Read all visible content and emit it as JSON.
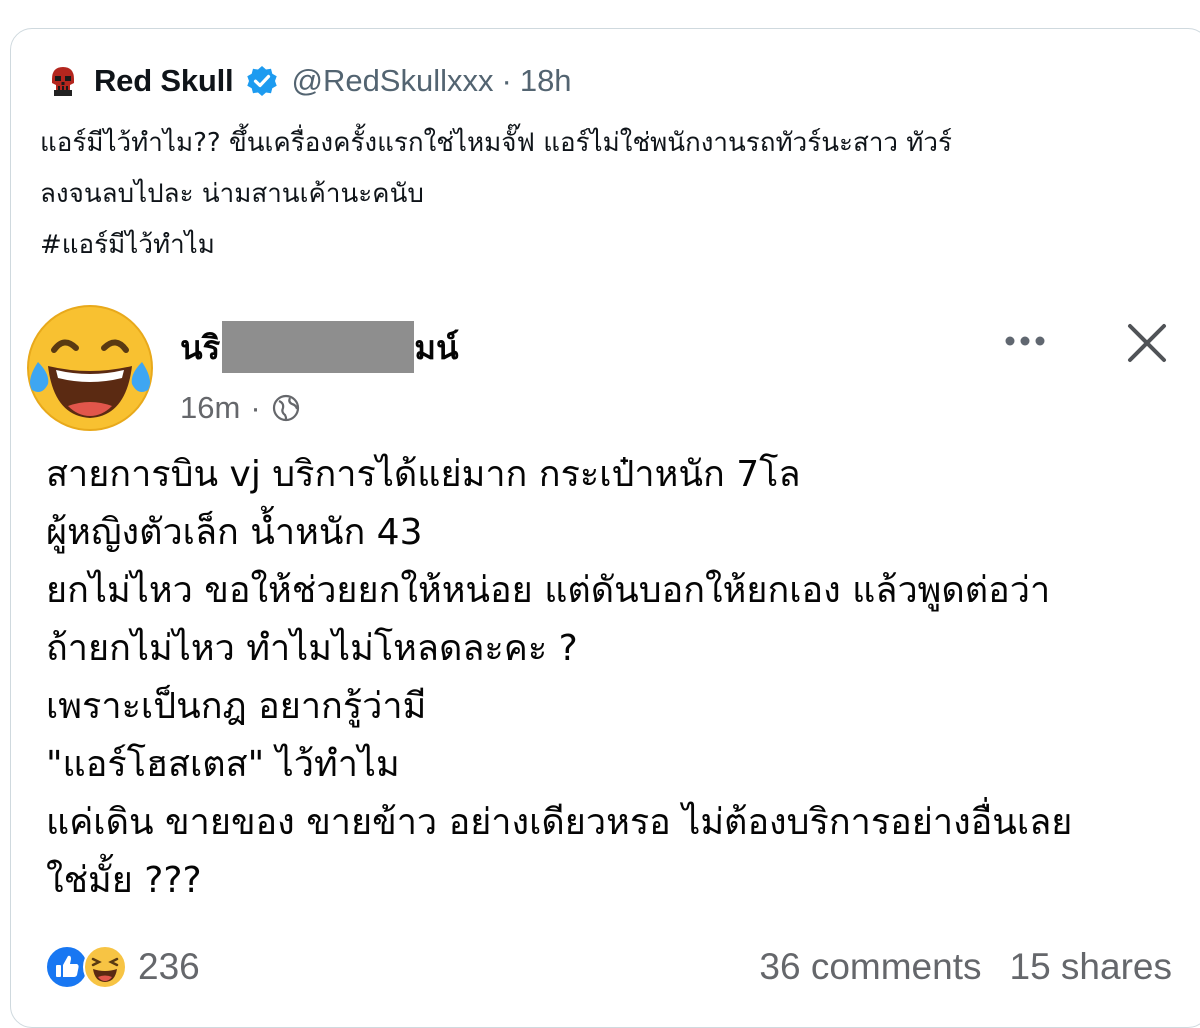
{
  "tweet": {
    "author_name": "Red Skull",
    "handle": "@RedSkullxxx",
    "separator": "·",
    "time": "18h",
    "text_lines": [
      "แอร์มีไว้ทำไม?? ขึ้นเครื่องครั้งแรกใช่ไหมจั๊ฟ แอร์ไม่ใช่พนักงานรถทัวร์นะสาว ทัวร์",
      "ลงจนลบไปละ น่ามสานเค้านะคนับ",
      "#แอร์มีไว้ทำไม"
    ],
    "icons": {
      "avatar": "red-skull-avatar-icon",
      "verified": "verified-badge-icon"
    },
    "colors": {
      "verified": "#1d9bf0",
      "handle": "#536471"
    }
  },
  "embedded_post": {
    "author_name_visible_start": "นริ",
    "author_name_visible_end": "มน์",
    "time": "16m",
    "separator": "·",
    "icons": {
      "avatar": "laughing-tears-emoji-icon",
      "privacy": "globe-icon",
      "more": "more-options-icon",
      "close": "close-icon"
    },
    "text_lines": [
      "สายการบิน vj บริการได้แย่มาก กระเป๋าหนัก 7โล",
      "ผู้หญิงตัวเล็ก น้ำหนัก 43",
      "ยกไม่ไหว ขอให้ช่วยยกให้หน่อย แต่ดันบอกให้ยกเอง แล้วพูดต่อว่า",
      "ถ้ายกไม่ไหว ทำไมไม่โหลดละคะ ?",
      "เพราะเป็นกฎ อยากรู้ว่ามี",
      "\"แอร์โฮสเตส\" ไว้ทำไม",
      "แค่เดิน ขายของ ขายข้าว อย่างเดียวหรอ ไม่ต้องบริการอย่างอื่นเลย",
      "ใช่มั้ย ???"
    ],
    "reactions": {
      "count": "236",
      "icons": [
        "like-reaction-icon",
        "haha-reaction-icon"
      ]
    },
    "comments": "36 comments",
    "shares": "15 shares",
    "colors": {
      "meta": "#65676b",
      "like": "#1877f2",
      "haha": "#f7c444"
    }
  }
}
